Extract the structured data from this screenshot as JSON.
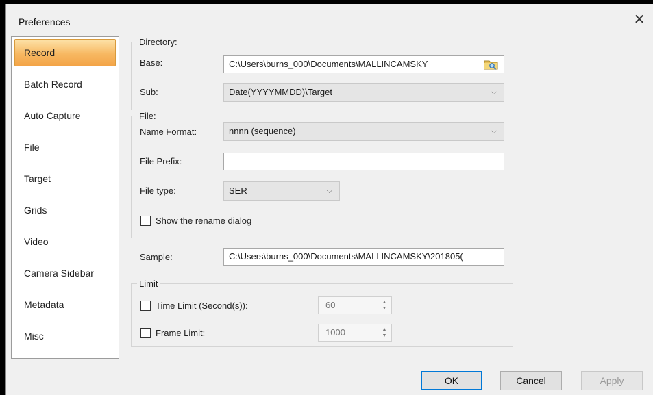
{
  "window": {
    "title": "Preferences",
    "close_glyph": "✕"
  },
  "sidebar": {
    "items": [
      {
        "label": "Record"
      },
      {
        "label": "Batch Record"
      },
      {
        "label": "Auto Capture"
      },
      {
        "label": "File"
      },
      {
        "label": "Target"
      },
      {
        "label": "Grids"
      },
      {
        "label": "Video"
      },
      {
        "label": "Camera Sidebar"
      },
      {
        "label": "Metadata"
      },
      {
        "label": "Misc"
      }
    ],
    "active": "Record"
  },
  "directory": {
    "legend": "Directory:",
    "base_label": "Base:",
    "base_value": "C:\\Users\\burns_000\\Documents\\MALLINCAMSKY",
    "sub_label": "Sub:",
    "sub_value": "Date(YYYYMMDD)\\Target"
  },
  "file": {
    "legend": "File:",
    "name_format_label": "Name Format:",
    "name_format_value": "nnnn (sequence)",
    "prefix_label": "File Prefix:",
    "prefix_value": "",
    "type_label": "File type:",
    "type_value": "SER",
    "rename_label": "Show the rename dialog",
    "rename_checked": false
  },
  "sample": {
    "label": "Sample:",
    "value": "C:\\Users\\burns_000\\Documents\\MALLINCAMSKY\\201805("
  },
  "limit": {
    "legend": "Limit",
    "time_label": "Time Limit (Second(s)):",
    "time_value": "60",
    "time_checked": false,
    "frame_label": "Frame Limit:",
    "frame_value": "1000",
    "frame_checked": false
  },
  "buttons": {
    "ok": "OK",
    "cancel": "Cancel",
    "apply": "Apply"
  },
  "colors": {
    "accent": "#f7b862",
    "focus": "#0078d7"
  },
  "icons": {
    "browse": "folder-browse-icon",
    "dropdown": "chevron-down-icon",
    "spin": "spin-arrows-icon"
  }
}
